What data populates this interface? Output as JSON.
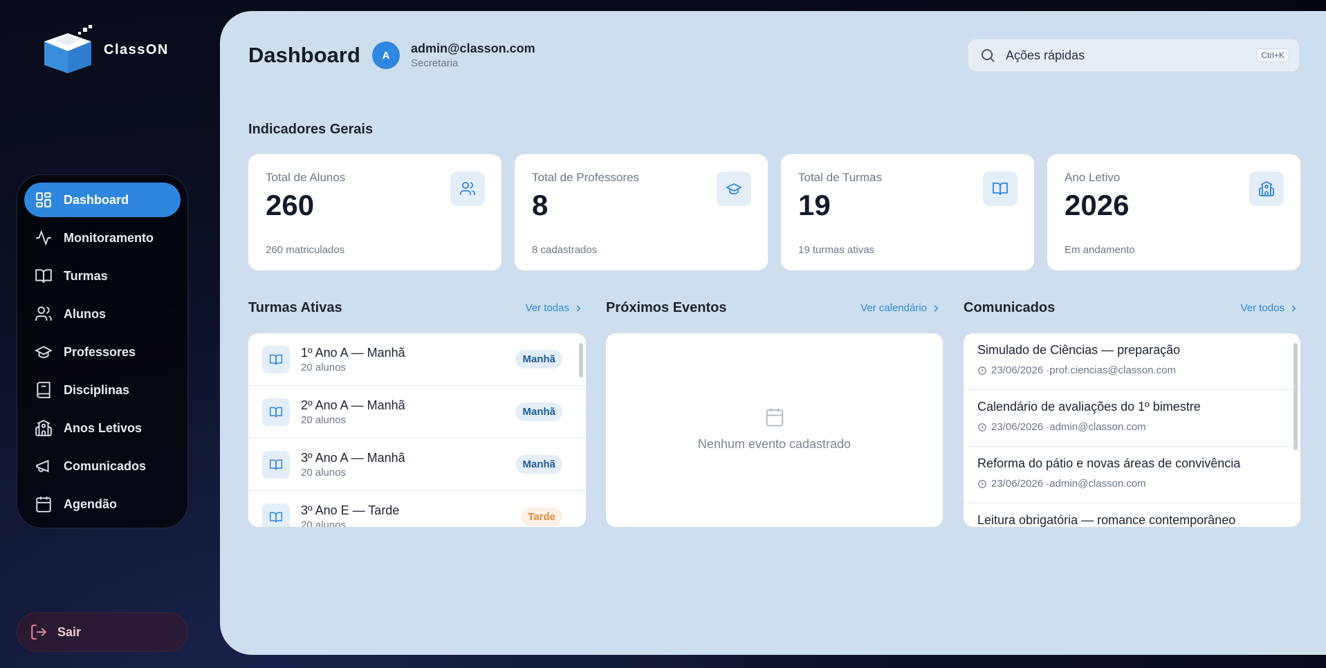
{
  "app": {
    "name": "ClassON"
  },
  "sidebar": {
    "items": [
      {
        "label": "Dashboard",
        "icon": "dashboard-icon",
        "active": true
      },
      {
        "label": "Monitoramento",
        "icon": "activity-icon"
      },
      {
        "label": "Turmas",
        "icon": "book-icon"
      },
      {
        "label": "Alunos",
        "icon": "users-icon"
      },
      {
        "label": "Professores",
        "icon": "graduation-cap-icon"
      },
      {
        "label": "Disciplinas",
        "icon": "notebook-icon"
      },
      {
        "label": "Anos Letivos",
        "icon": "school-icon"
      },
      {
        "label": "Comunicados",
        "icon": "megaphone-icon"
      },
      {
        "label": "Agendão",
        "icon": "calendar-icon"
      }
    ],
    "logout_label": "Sair"
  },
  "header": {
    "title": "Dashboard",
    "avatar_initial": "A",
    "user_email": "admin@classon.com",
    "user_role": "Secretaria",
    "search_placeholder": "Ações rápidas",
    "search_shortcut": "Ctrl+K"
  },
  "indicators": {
    "title": "Indicadores Gerais",
    "cards": [
      {
        "label": "Total de Alunos",
        "value": "260",
        "sub": "260 matriculados",
        "icon": "users-icon"
      },
      {
        "label": "Total de Professores",
        "value": "8",
        "sub": "8 cadastrados",
        "icon": "graduation-cap-icon"
      },
      {
        "label": "Total de Turmas",
        "value": "19",
        "sub": "19 turmas ativas",
        "icon": "book-icon"
      },
      {
        "label": "Ano Letivo",
        "value": "2026",
        "sub": "Em andamento",
        "icon": "school-icon"
      }
    ]
  },
  "classes": {
    "title": "Turmas Ativas",
    "link": "Ver todas",
    "rows": [
      {
        "name": "1º Ano A — Manhã",
        "sub": "20 alunos",
        "badge": "Manhã",
        "shift": "manha"
      },
      {
        "name": "2º Ano A — Manhã",
        "sub": "20 alunos",
        "badge": "Manhã",
        "shift": "manha"
      },
      {
        "name": "3º Ano A — Manhã",
        "sub": "20 alunos",
        "badge": "Manhã",
        "shift": "manha"
      },
      {
        "name": "3º Ano E — Tarde",
        "sub": "20 alunos",
        "badge": "Tarde",
        "shift": "tarde"
      }
    ]
  },
  "events": {
    "title": "Próximos Eventos",
    "link": "Ver calendário",
    "empty": "Nenhum evento cadastrado"
  },
  "announcements": {
    "title": "Comunicados",
    "link": "Ver todos",
    "rows": [
      {
        "title": "Simulado de Ciências — preparação",
        "meta": "23/06/2026 ·prof.ciencias@classon.com"
      },
      {
        "title": "Calendário de avaliações do 1º bimestre",
        "meta": "23/06/2026 ·admin@classon.com"
      },
      {
        "title": "Reforma do pátio e novas áreas de convivência",
        "meta": "23/06/2026 ·admin@classon.com"
      },
      {
        "title": "Leitura obrigatória — romance contemporâneo",
        "meta": ""
      }
    ]
  }
}
